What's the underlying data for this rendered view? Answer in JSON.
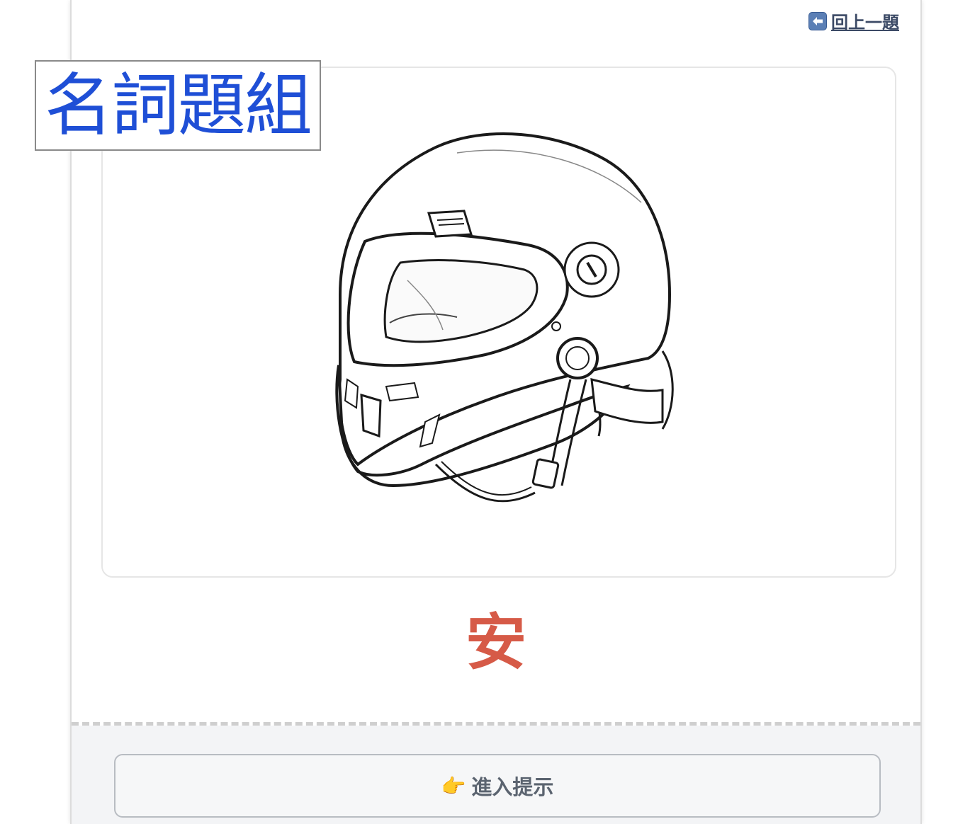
{
  "back_link": {
    "label": "回上一題",
    "icon": "back-arrow-icon"
  },
  "image": {
    "alt": "helmet-illustration"
  },
  "answer": {
    "text": "安",
    "color": "#d65a47"
  },
  "hint_button": {
    "label": "進入提示",
    "icon": "pointing-hand-icon",
    "icon_glyph": "👉"
  },
  "overlay_label": {
    "text": "名詞題組",
    "color": "#1f4fd6"
  }
}
